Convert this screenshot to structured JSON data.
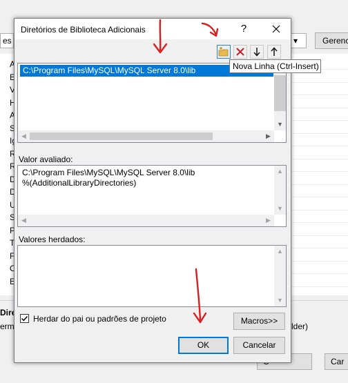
{
  "background": {
    "combo_right_arrow": "▾",
    "gerenc_button": "Gerenc",
    "left_letters": [
      "A",
      "E",
      "V",
      "H",
      "A",
      "S",
      "Ig",
      "R",
      "R",
      "D",
      "D",
      "U",
      "S",
      "P",
      "T",
      "F",
      "C",
      "E"
    ],
    "bottom_bold": "Diret",
    "bottom_term": "erm",
    "bottom_lder": "lder)",
    "btn_1": "C",
    "btn_2": "Car"
  },
  "dialog": {
    "title": "Diretórios de Biblioteca Adicionais",
    "help_label": "?",
    "toolbar": {
      "new_line_tooltip": "Nova Linha (Ctrl-Insert)"
    },
    "directories": [
      "C:\\Program Files\\MySQL\\MySQL Server 8.0\\lib"
    ],
    "evaluated_label": "Valor avaliado:",
    "evaluated_values": [
      "C:\\Program Files\\MySQL\\MySQL Server 8.0\\lib",
      "%(AdditionalLibraryDirectories)"
    ],
    "inherited_label": "Valores herdados:",
    "inherit_checkbox_label": "Herdar do pai ou padrões de projeto",
    "inherit_checked": true,
    "macros_button": "Macros>>",
    "ok_button": "OK",
    "cancel_button": "Cancelar"
  },
  "colors": {
    "selection": "#0078d7",
    "annotation_red": "#d81e1e",
    "dialog_bg": "#f0f0f0"
  }
}
